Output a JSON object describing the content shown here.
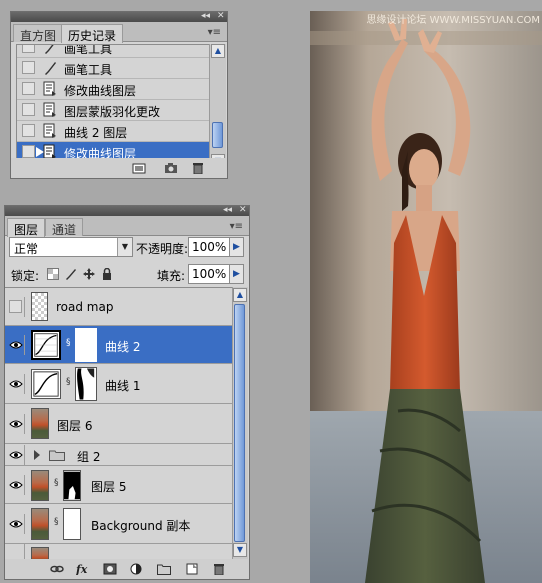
{
  "watermark": "思缘设计论坛 WWW.MISSYUAN.COM",
  "history_panel": {
    "tabs": [
      "直方图",
      "历史记录"
    ],
    "active_tab": 1,
    "items": [
      {
        "label": "画笔工具",
        "icon": "brush-icon",
        "selected": false
      },
      {
        "label": "画笔工具",
        "icon": "brush-icon",
        "selected": false
      },
      {
        "label": "修改曲线图层",
        "icon": "history-state-icon",
        "selected": false
      },
      {
        "label": "图层蒙版羽化更改",
        "icon": "history-state-icon",
        "selected": false
      },
      {
        "label": "曲线 2 图层",
        "icon": "history-state-icon",
        "selected": false
      },
      {
        "label": "修改曲线图层",
        "icon": "history-state-icon",
        "selected": true
      }
    ],
    "footer_icons": [
      "new-document-from-state-icon",
      "new-snapshot-icon",
      "delete-state-icon"
    ]
  },
  "layers_panel": {
    "tabs": [
      "图层",
      "通道"
    ],
    "active_tab": 0,
    "blend_mode": "正常",
    "opacity_label": "不透明度:",
    "opacity_value": "100%",
    "lock_label": "锁定:",
    "fill_label": "填充:",
    "fill_value": "100%",
    "layers": [
      {
        "name": "road map",
        "visible": false,
        "type": "transparent",
        "selected": false
      },
      {
        "name": "曲线 2",
        "visible": true,
        "type": "curves",
        "mask": "white",
        "selected": true
      },
      {
        "name": "曲线 1",
        "visible": true,
        "type": "curves",
        "mask": "figure",
        "selected": false
      },
      {
        "name": "图层 6",
        "visible": true,
        "type": "photo",
        "selected": false
      },
      {
        "name": "组 2",
        "visible": true,
        "type": "group",
        "selected": false
      },
      {
        "name": "图层 5",
        "visible": true,
        "type": "photo",
        "mask": "black-figure",
        "selected": false
      },
      {
        "name": "Background 副本",
        "visible": true,
        "type": "photo",
        "mask": "white",
        "selected": false
      }
    ],
    "footer_icons": [
      "link-layers-icon",
      "layer-style-fx-icon",
      "add-mask-icon",
      "adjustment-layer-icon",
      "new-group-icon",
      "new-layer-icon",
      "delete-layer-icon"
    ]
  },
  "colors": {
    "selection": "#3a6ec4",
    "panel_bg": "#d4d4d4",
    "workspace": "#a8a8a8"
  }
}
